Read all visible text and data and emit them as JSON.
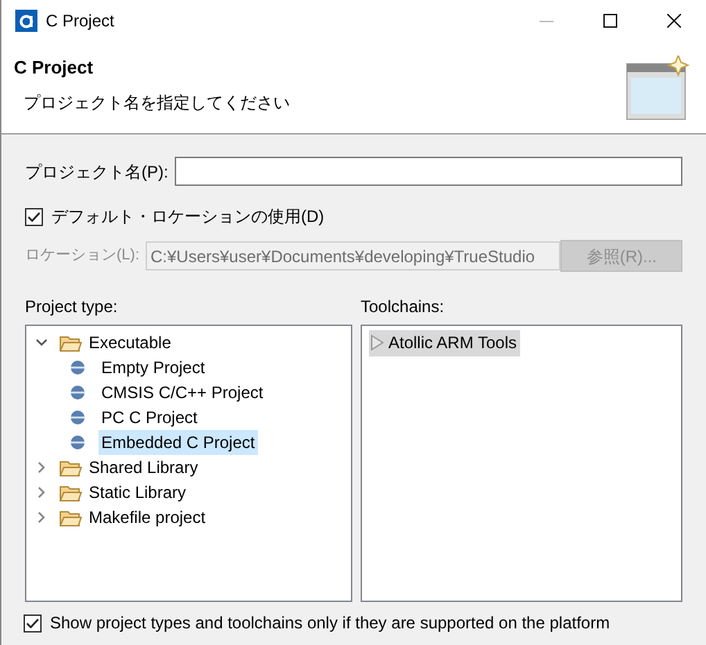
{
  "window": {
    "title": "C Project"
  },
  "header": {
    "title": "C Project",
    "subtitle": "プロジェクト名を指定してください"
  },
  "project_name": {
    "label": "プロジェクト名(P):"
  },
  "default_location": {
    "label": "デフォルト・ロケーションの使用(D)",
    "checked": true
  },
  "location": {
    "label": "ロケーション(L):",
    "value": "C:¥Users¥user¥Documents¥developing¥TrueStudio",
    "disabled": true,
    "button": "参照(R)..."
  },
  "project_type": {
    "label": "Project type:",
    "items": [
      {
        "label": "Executable",
        "kind": "folder",
        "expanded": true,
        "selected": false,
        "children": [
          {
            "label": "Empty Project",
            "kind": "project",
            "selected": false
          },
          {
            "label": "CMSIS C/C++ Project",
            "kind": "project",
            "selected": false
          },
          {
            "label": "PC C Project",
            "kind": "project",
            "selected": false
          },
          {
            "label": "Embedded C Project",
            "kind": "project",
            "selected": true
          }
        ]
      },
      {
        "label": "Shared Library",
        "kind": "folder",
        "expanded": false,
        "selected": false
      },
      {
        "label": "Static Library",
        "kind": "folder",
        "expanded": false,
        "selected": false
      },
      {
        "label": "Makefile project",
        "kind": "folder",
        "expanded": false,
        "selected": false
      }
    ]
  },
  "toolchains": {
    "label": "Toolchains:",
    "items": [
      {
        "label": "Atollic ARM Tools",
        "selected": true
      }
    ]
  },
  "filter": {
    "label": "Show project types and toolchains only if they are supported on the platform",
    "checked": true
  }
}
